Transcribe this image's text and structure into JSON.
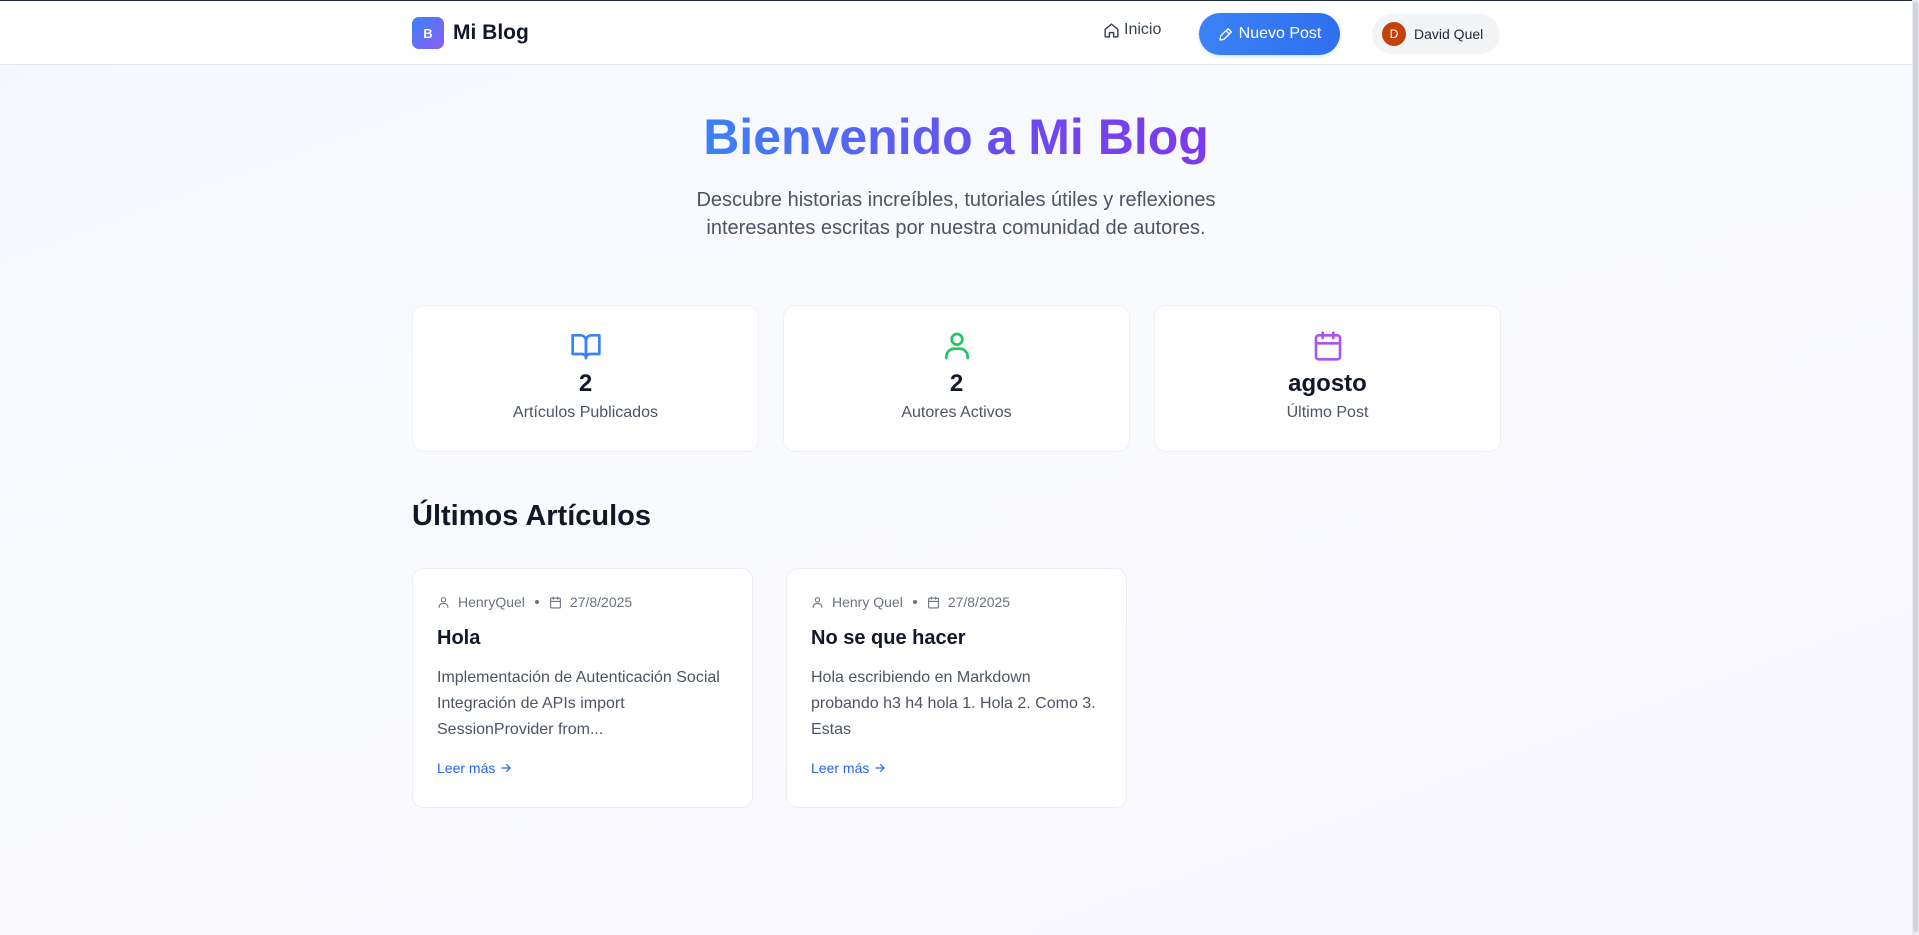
{
  "header": {
    "logo_letter": "B",
    "logo_text": "Mi Blog",
    "nav_home": "Inicio",
    "new_post": "Nuevo Post",
    "user_initial": "D",
    "user_name": "David Quel"
  },
  "hero": {
    "title": "Bienvenido a Mi Blog",
    "subtitle": "Descubre historias increíbles, tutoriales útiles y reflexiones interesantes escritas por nuestra comunidad de autores."
  },
  "stats": [
    {
      "icon": "book-open-icon",
      "color": "#3b82f6",
      "value": "2",
      "label": "Artículos Publicados"
    },
    {
      "icon": "user-icon",
      "color": "#22c55e",
      "value": "2",
      "label": "Autores Activos"
    },
    {
      "icon": "calendar-icon",
      "color": "#a855f7",
      "value": "agosto",
      "label": "Último Post"
    }
  ],
  "section_title": "Últimos Artículos",
  "posts": [
    {
      "author": "HenryQuel",
      "date": "27/8/2025",
      "title": "Hola",
      "excerpt": "Implementación de Autenticación Social Integración de APIs import SessionProvider from...",
      "link": "Leer más"
    },
    {
      "author": "Henry Quel",
      "date": "27/8/2025",
      "title": "No se que hacer",
      "excerpt": "Hola escribiendo en Markdown probando h3 h4 hola 1. Hola 2. Como 3. Estas",
      "link": "Leer más"
    }
  ],
  "colors": {
    "accent": "#3b82f6",
    "brand_gradient": [
      "#3b82f6",
      "#8b5cf6"
    ],
    "link": "#2563eb"
  }
}
